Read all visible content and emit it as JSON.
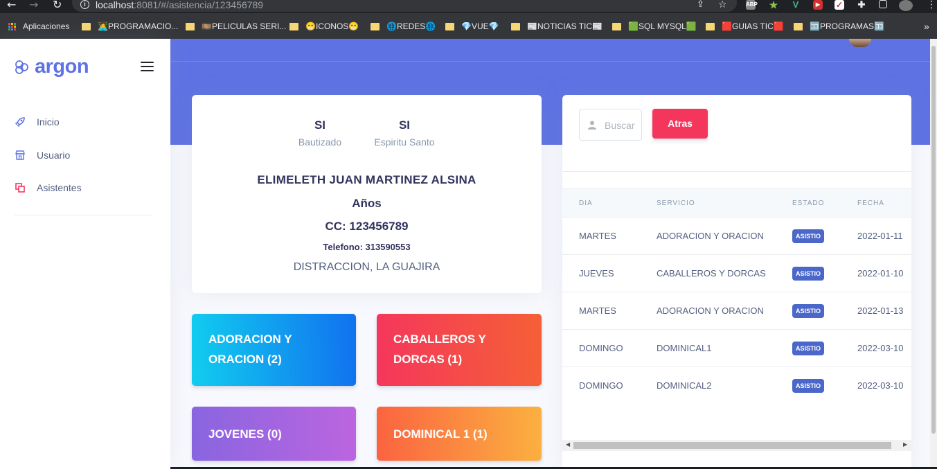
{
  "browser": {
    "url_host": "localhost",
    "url_path": ":8081/#/asistencia/123456789",
    "bookmarks": [
      {
        "label": "Aplicaciones",
        "kind": "apps"
      },
      {
        "label": "👩‍💻PROGRAMACIO...",
        "kind": "folder"
      },
      {
        "label": "🎞️PELICULAS SERI...",
        "kind": "folder"
      },
      {
        "label": "😁ICONOS😁",
        "kind": "folder"
      },
      {
        "label": "🌐REDES🌐",
        "kind": "folder"
      },
      {
        "label": "💎VUE💎",
        "kind": "folder"
      },
      {
        "label": "📰NOTICIAS TIC📰",
        "kind": "folder"
      },
      {
        "label": "🟩SQL MYSQL🟩",
        "kind": "folder"
      },
      {
        "label": "🟥GUIAS TIC🟥",
        "kind": "folder"
      },
      {
        "label": "🈁PROGRAMAS🈁",
        "kind": "folder"
      }
    ],
    "more": "»"
  },
  "sidebar": {
    "brand": "argon",
    "items": [
      {
        "label": "Inicio",
        "icon": "rocket-icon",
        "color": "#5e72e4"
      },
      {
        "label": "Usuario",
        "icon": "shop-icon",
        "color": "#5e72e4"
      },
      {
        "label": "Asistentes",
        "icon": "copy-icon",
        "color": "#f5365c"
      }
    ]
  },
  "profile": {
    "bautizado_value": "SI",
    "bautizado_label": "Bautizado",
    "espiritu_value": "SI",
    "espiritu_label": "Espiritu Santo",
    "name": "ELIMELETH JUAN MARTINEZ ALSINA",
    "age": "Años",
    "cc": "CC: 123456789",
    "phone": "Telefono: 313590553",
    "location": "DISTRACCION, LA GUAJIRA"
  },
  "services": [
    {
      "line1": "ADORACION Y",
      "line2": "ORACION (2)",
      "gradient": [
        "#11cdef",
        "#1171ef"
      ]
    },
    {
      "line1": "CABALLEROS Y",
      "line2": "DORCAS (1)",
      "gradient": [
        "#f5365c",
        "#f56036"
      ]
    },
    {
      "line1": "JOVENES (0)",
      "line2": "",
      "gradient": [
        "#8965e0",
        "#bc65e0"
      ]
    },
    {
      "line1": "DOMINICAL 1 (1)",
      "line2": "",
      "gradient": [
        "#fb6340",
        "#fbb140"
      ]
    }
  ],
  "table": {
    "search_placeholder": "Buscar",
    "back_button": "Atras",
    "columns": [
      "DIA",
      "SERVICIO",
      "ESTADO",
      "FECHA"
    ],
    "rows": [
      {
        "dia": "MARTES",
        "servicio": "ADORACION Y ORACION",
        "estado": "ASISTIO",
        "fecha": "2022-01-11"
      },
      {
        "dia": "JUEVES",
        "servicio": "CABALLEROS Y DORCAS",
        "estado": "ASISTIO",
        "fecha": "2022-01-10"
      },
      {
        "dia": "MARTES",
        "servicio": "ADORACION Y ORACION",
        "estado": "ASISTIO",
        "fecha": "2022-01-13"
      },
      {
        "dia": "DOMINGO",
        "servicio": "DOMINICAL1",
        "estado": "ASISTIO",
        "fecha": "2022-03-10"
      },
      {
        "dia": "DOMINGO",
        "servicio": "DOMINICAL2",
        "estado": "ASISTIO",
        "fecha": "2022-03-10"
      }
    ]
  },
  "colors": {
    "primary": "#5e72e4",
    "danger": "#f5365c",
    "badge": "#4a67c9"
  }
}
